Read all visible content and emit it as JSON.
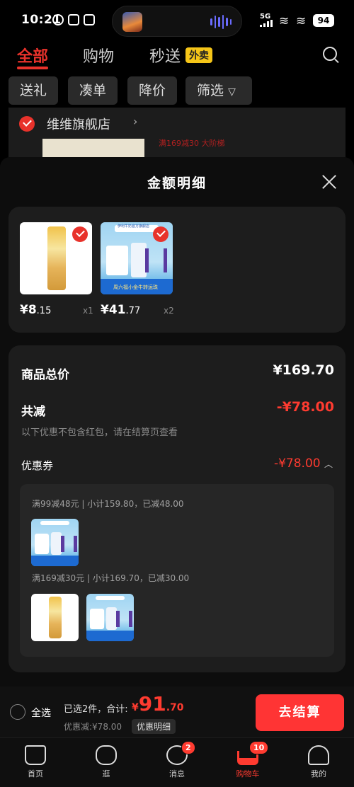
{
  "status_bar": {
    "time": "10:21",
    "network": "5G",
    "battery": "94"
  },
  "top_tabs": [
    {
      "label": "全部",
      "active": true
    },
    {
      "label": "购物"
    },
    {
      "label": "秒送"
    }
  ],
  "waimai_badge": "外卖",
  "filter_chips": [
    "送礼",
    "凑单",
    "降价",
    "筛选"
  ],
  "store": {
    "name": "维维旗舰店",
    "promo": "满169减30 大阶梯"
  },
  "sheet": {
    "title": "金额明细",
    "products": [
      {
        "price_int": "¥8",
        "price_dec": ".15",
        "qty": "x1",
        "image": "nut-cereal-package"
      },
      {
        "price_int": "¥41",
        "price_dec": ".77",
        "qty": "x2",
        "image": "milk-box-set"
      }
    ],
    "milk_banner_text": "伊利牛奶官方旗舰店",
    "milk_ribbon_text": "周六福小金牛转运珠",
    "total_label": "商品总价",
    "total_value": "¥169.70",
    "discount_label": "共减",
    "discount_value": "-¥78.00",
    "discount_note": "以下优惠不包含红包，请在结算页查看",
    "coupon_label": "优惠券",
    "coupon_value": "-¥78.00",
    "coupon_groups": [
      {
        "text": "满99减48元 | 小计159.80，已减48.00"
      },
      {
        "text": "满169减30元 | 小计169.70，已减30.00"
      }
    ]
  },
  "bottom_bar": {
    "select_all": "全选",
    "selected_text": "已选2件，合计:",
    "total_symbol": "¥",
    "total_int": "91",
    "total_dec": ".70",
    "discount_text": "优惠减:¥78.00",
    "detail_button": "优惠明细",
    "checkout_button": "去结算"
  },
  "nav": [
    {
      "label": "首页",
      "icon": "home-icon"
    },
    {
      "label": "逛",
      "icon": "browse-icon"
    },
    {
      "label": "消息",
      "icon": "message-icon",
      "badge": "2"
    },
    {
      "label": "购物车",
      "icon": "cart-icon",
      "badge": "10",
      "active": true
    },
    {
      "label": "我的",
      "icon": "profile-icon"
    }
  ],
  "colors": {
    "accent": "#ff3b30",
    "brand_red": "#e8322b",
    "checkout": "#ff3434",
    "waimai": "#f5c518"
  }
}
